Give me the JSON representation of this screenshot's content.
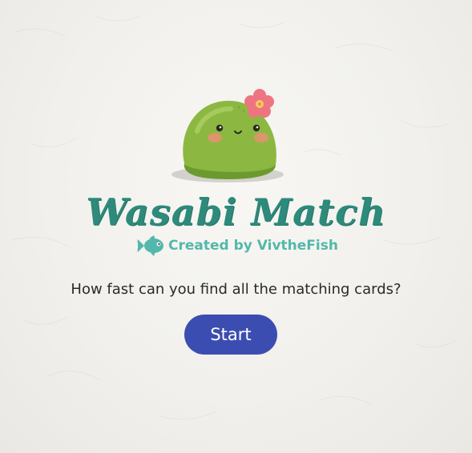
{
  "game": {
    "title": "Wasabi Match",
    "credit": "Created by VivtheFish",
    "prompt": "How fast can you find all the matching cards?",
    "start_label": "Start"
  },
  "icons": {
    "mascot": "wasabi-blob-with-flower",
    "credit_icon": "fish-icon"
  },
  "colors": {
    "title": "#2e8a7b",
    "credit": "#53b8ab",
    "button": "#3c4db1",
    "button_text": "#ffffff",
    "mascot_green": "#8cb842",
    "flower_pink": "#ee7580"
  }
}
